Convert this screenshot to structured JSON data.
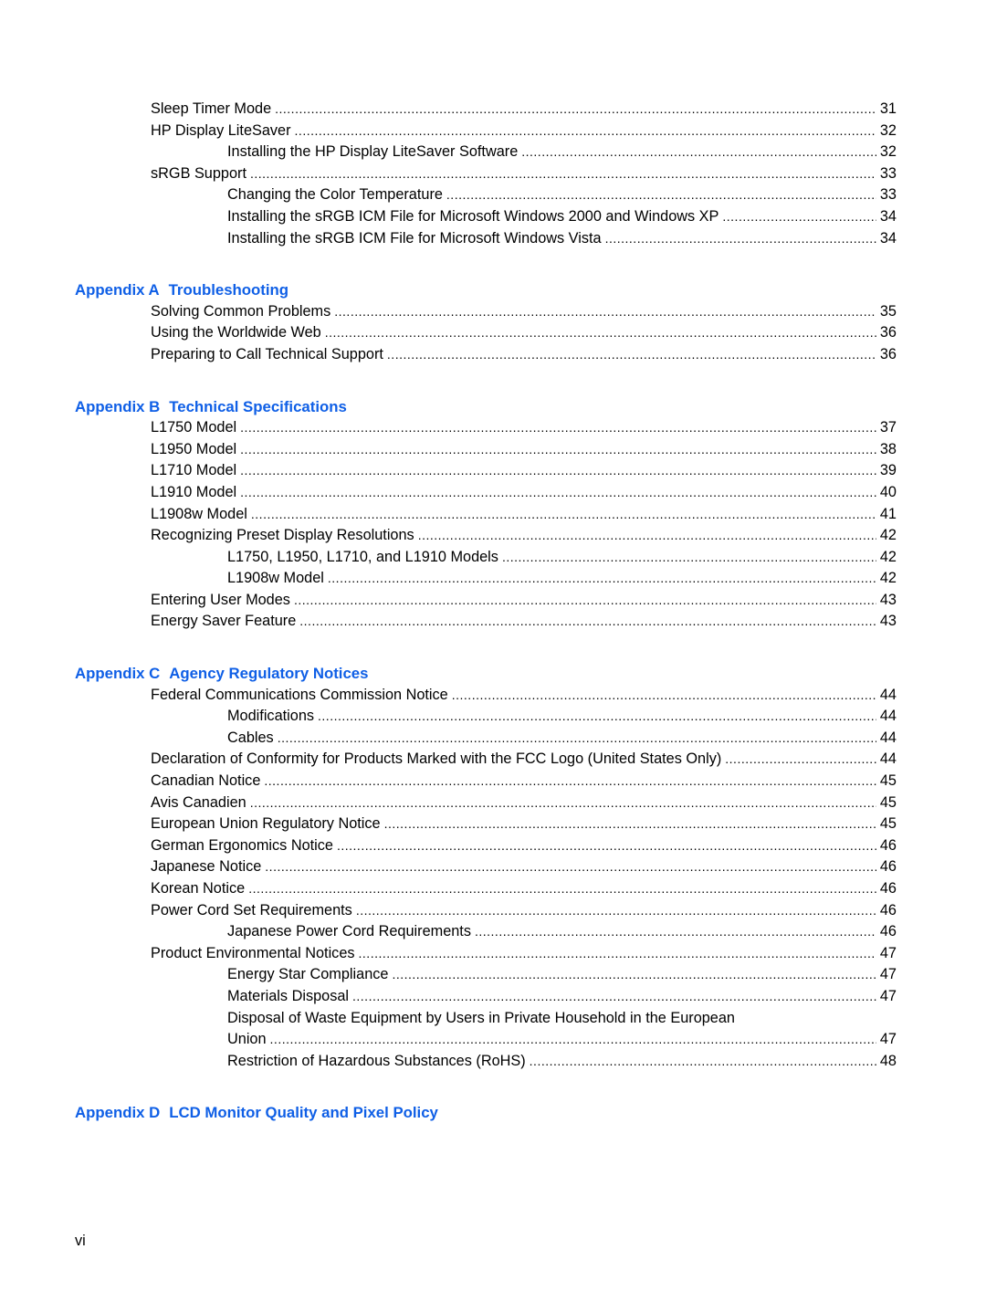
{
  "document": {
    "type": "Table of Contents (continued)",
    "page_label": "vi"
  },
  "toc_sections": [
    {
      "heading": null,
      "entries": [
        {
          "level": 1,
          "title": "Sleep Timer Mode",
          "page": "31"
        },
        {
          "level": 1,
          "title": "HP Display LiteSaver",
          "page": "32"
        },
        {
          "level": 2,
          "title": "Installing the HP Display LiteSaver Software",
          "page": "32"
        },
        {
          "level": 1,
          "title": "sRGB Support",
          "page": "33"
        },
        {
          "level": 2,
          "title": "Changing the Color Temperature",
          "page": "33"
        },
        {
          "level": 2,
          "title": "Installing the sRGB ICM File for Microsoft Windows 2000 and Windows XP",
          "page": "34"
        },
        {
          "level": 2,
          "title": "Installing the sRGB ICM File for Microsoft Windows Vista",
          "page": "34"
        }
      ]
    },
    {
      "heading": {
        "label": "Appendix A",
        "title": "Troubleshooting"
      },
      "entries": [
        {
          "level": 1,
          "title": "Solving Common Problems",
          "page": "35"
        },
        {
          "level": 1,
          "title": "Using the Worldwide Web",
          "page": "36"
        },
        {
          "level": 1,
          "title": "Preparing to Call Technical Support",
          "page": "36"
        }
      ]
    },
    {
      "heading": {
        "label": "Appendix B",
        "title": "Technical Specifications"
      },
      "entries": [
        {
          "level": 1,
          "title": "L1750 Model",
          "page": "37"
        },
        {
          "level": 1,
          "title": "L1950 Model",
          "page": "38"
        },
        {
          "level": 1,
          "title": "L1710 Model",
          "page": "39"
        },
        {
          "level": 1,
          "title": "L1910 Model",
          "page": "40"
        },
        {
          "level": 1,
          "title": "L1908w Model",
          "page": "41"
        },
        {
          "level": 1,
          "title": "Recognizing Preset Display Resolutions",
          "page": "42"
        },
        {
          "level": 2,
          "title": "L1750, L1950, L1710, and L1910 Models",
          "page": "42"
        },
        {
          "level": 2,
          "title": "L1908w Model",
          "page": "42"
        },
        {
          "level": 1,
          "title": "Entering User Modes",
          "page": "43"
        },
        {
          "level": 1,
          "title": "Energy Saver Feature",
          "page": "43"
        }
      ]
    },
    {
      "heading": {
        "label": "Appendix C",
        "title": "Agency Regulatory Notices"
      },
      "entries": [
        {
          "level": 1,
          "title": "Federal Communications Commission Notice",
          "page": "44"
        },
        {
          "level": 2,
          "title": "Modifications",
          "page": "44"
        },
        {
          "level": 2,
          "title": "Cables",
          "page": "44"
        },
        {
          "level": 1,
          "title": "Declaration of Conformity for Products Marked with the FCC Logo (United States Only)",
          "page": "44"
        },
        {
          "level": 1,
          "title": "Canadian Notice",
          "page": "45"
        },
        {
          "level": 1,
          "title": "Avis Canadien",
          "page": "45"
        },
        {
          "level": 1,
          "title": "European Union Regulatory Notice",
          "page": "45"
        },
        {
          "level": 1,
          "title": "German Ergonomics Notice",
          "page": "46"
        },
        {
          "level": 1,
          "title": "Japanese Notice",
          "page": "46"
        },
        {
          "level": 1,
          "title": "Korean Notice",
          "page": "46"
        },
        {
          "level": 1,
          "title": "Power Cord Set Requirements",
          "page": "46"
        },
        {
          "level": 2,
          "title": "Japanese Power Cord Requirements",
          "page": "46"
        },
        {
          "level": 1,
          "title": "Product Environmental Notices",
          "page": "47"
        },
        {
          "level": 2,
          "title": "Energy Star Compliance",
          "page": "47"
        },
        {
          "level": 2,
          "title": "Materials Disposal",
          "page": "47"
        },
        {
          "level": 2,
          "title": "Disposal of Waste Equipment by Users in Private Household in the European",
          "continuation": "Union",
          "page": "47"
        },
        {
          "level": 2,
          "title": "Restriction of Hazardous Substances (RoHS)",
          "page": "48"
        }
      ]
    },
    {
      "heading": {
        "label": "Appendix D",
        "title": "LCD Monitor Quality and Pixel Policy"
      },
      "entries": []
    }
  ],
  "colors": {
    "heading": "#0f5fe6",
    "text": "#000000",
    "background": "#ffffff"
  }
}
